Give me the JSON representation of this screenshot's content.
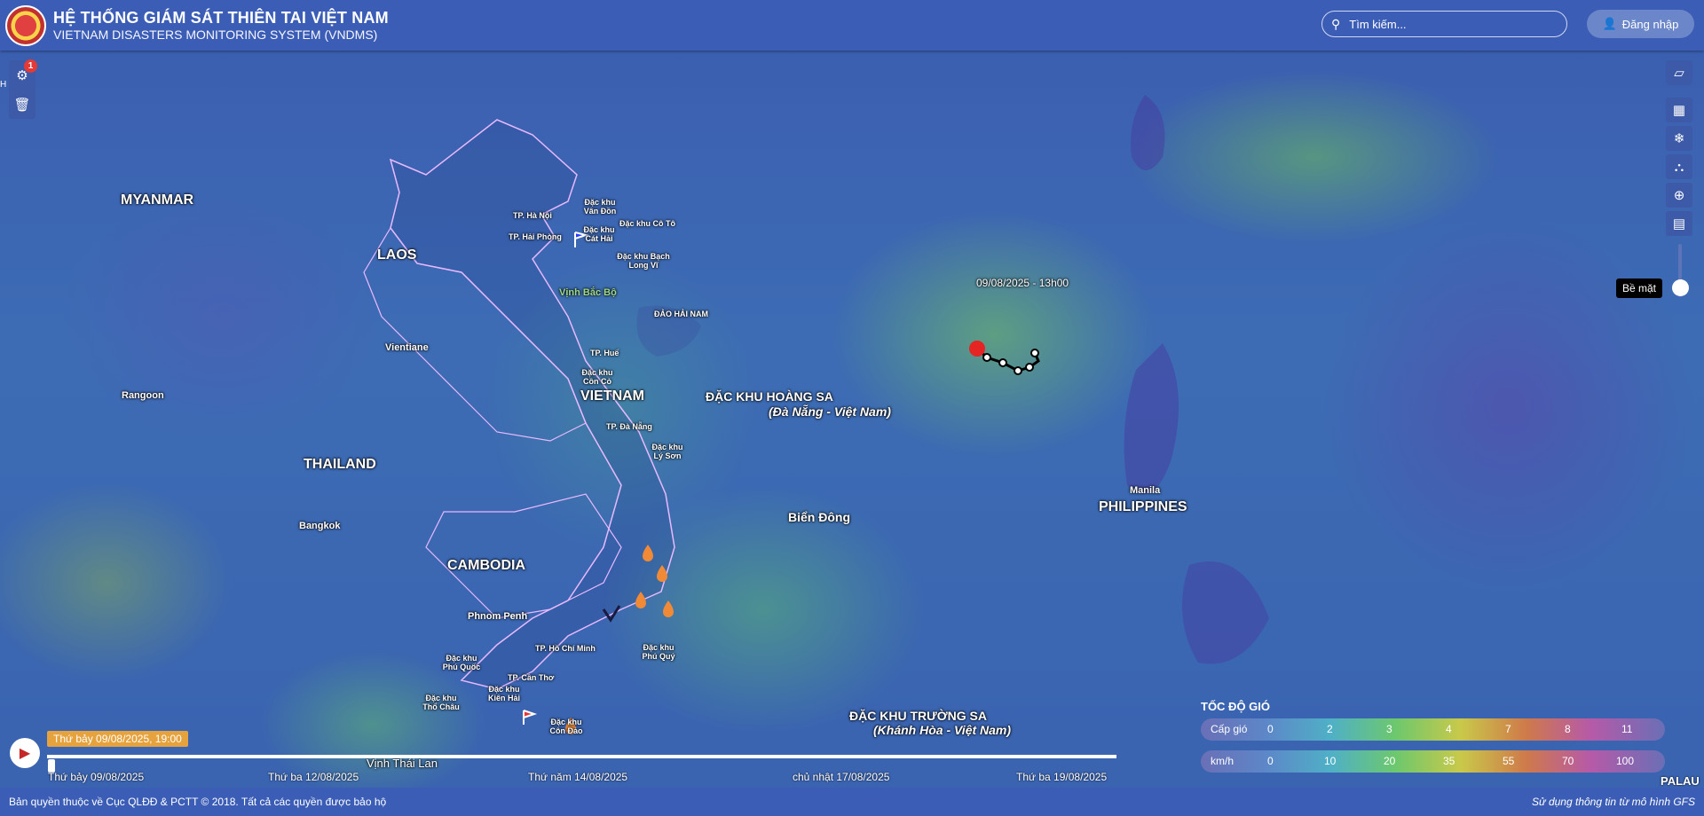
{
  "header": {
    "title": "HỆ THỐNG GIÁM SÁT THIÊN TAI VIỆT NAM",
    "subtitle": "VIETNAM DISASTERS MONITORING SYSTEM (VNDMS)",
    "search_placeholder": "Tìm kiếm...",
    "login_label": "Đăng nhập"
  },
  "left_tools": {
    "badge_count": "1",
    "edge_letter": "H"
  },
  "map_labels": {
    "myanmar": "MYANMAR",
    "laos": "LAOS",
    "thailand": "THAILAND",
    "cambodia": "CAMBODIA",
    "vietnam": "VIETNAM",
    "philippines": "PHILIPPINES",
    "vientiane": "Vientiane",
    "rangoon": "Rangoon",
    "bangkok": "Bangkok",
    "phnom_penh": "Phnom Penh",
    "manila": "Manila",
    "hanoi": "TP. Hà Nội",
    "haiphong": "TP. Hải Phòng",
    "hue": "TP. Huế",
    "danang": "TP. Đà Nẵng",
    "hcm": "TP. Hồ Chí Minh",
    "cantho": "TP. Cần Thơ",
    "van_don": "Đặc khu Vân Đồn",
    "co_to": "Đặc khu Cô Tô",
    "cat_hai": "Đặc khu Cát Hải",
    "bach_long_vi": "Đặc khu Bạch Long Vĩ",
    "con_co": "Đặc khu Cồn Cỏ",
    "ly_son": "Đặc khu Lý Sơn",
    "phu_quy": "Đặc khu Phú Quý",
    "phu_quoc": "Đặc khu Phú Quốc",
    "tho_chau": "Đặc khu Thổ Châu",
    "kien_hai": "Đặc khu Kiên Hải",
    "con_dao": "Đặc khu Côn Đảo",
    "vinh_bac_bo": "Vịnh Bắc Bộ",
    "dao_hai_nam": "ĐẢO HẢI NAM",
    "hoang_sa": "ĐẶC KHU HOÀNG SA",
    "hoang_sa_sub": "(Đà Nẵng - Việt Nam)",
    "bien_dong": "Biển Đông",
    "truong_sa": "ĐẶC KHU TRƯỜNG SA",
    "truong_sa_sub": "(Khánh Hòa - Việt Nam)",
    "vinh_thai_lan": "Vịnh Thái Lan",
    "palau": "PALAU"
  },
  "storm": {
    "label": "09/08/2025 - 13h00"
  },
  "layer_tooltip": "Bề mặt",
  "timeline": {
    "current": "Thứ bảy 09/08/2025, 19:00",
    "ticks": [
      "Thứ bảy 09/08/2025",
      "Thứ ba 12/08/2025",
      "Thứ năm 14/08/2025",
      "chủ nhật 17/08/2025",
      "Thứ ba 19/08/2025"
    ]
  },
  "legend": {
    "title": "TỐC ĐỘ GIÓ",
    "level_label": "Cấp gió",
    "levels": [
      "0",
      "2",
      "3",
      "4",
      "7",
      "8",
      "11"
    ],
    "kmh_label": "km/h",
    "kmh": [
      "0",
      "10",
      "20",
      "35",
      "55",
      "70",
      "100"
    ]
  },
  "footer": {
    "copyright": "Bản quyền thuộc về Cục QLĐĐ & PCTT © 2018. Tất cả các quyền được bảo hộ",
    "source": "Sử dụng thông tin từ mô hình GFS"
  }
}
